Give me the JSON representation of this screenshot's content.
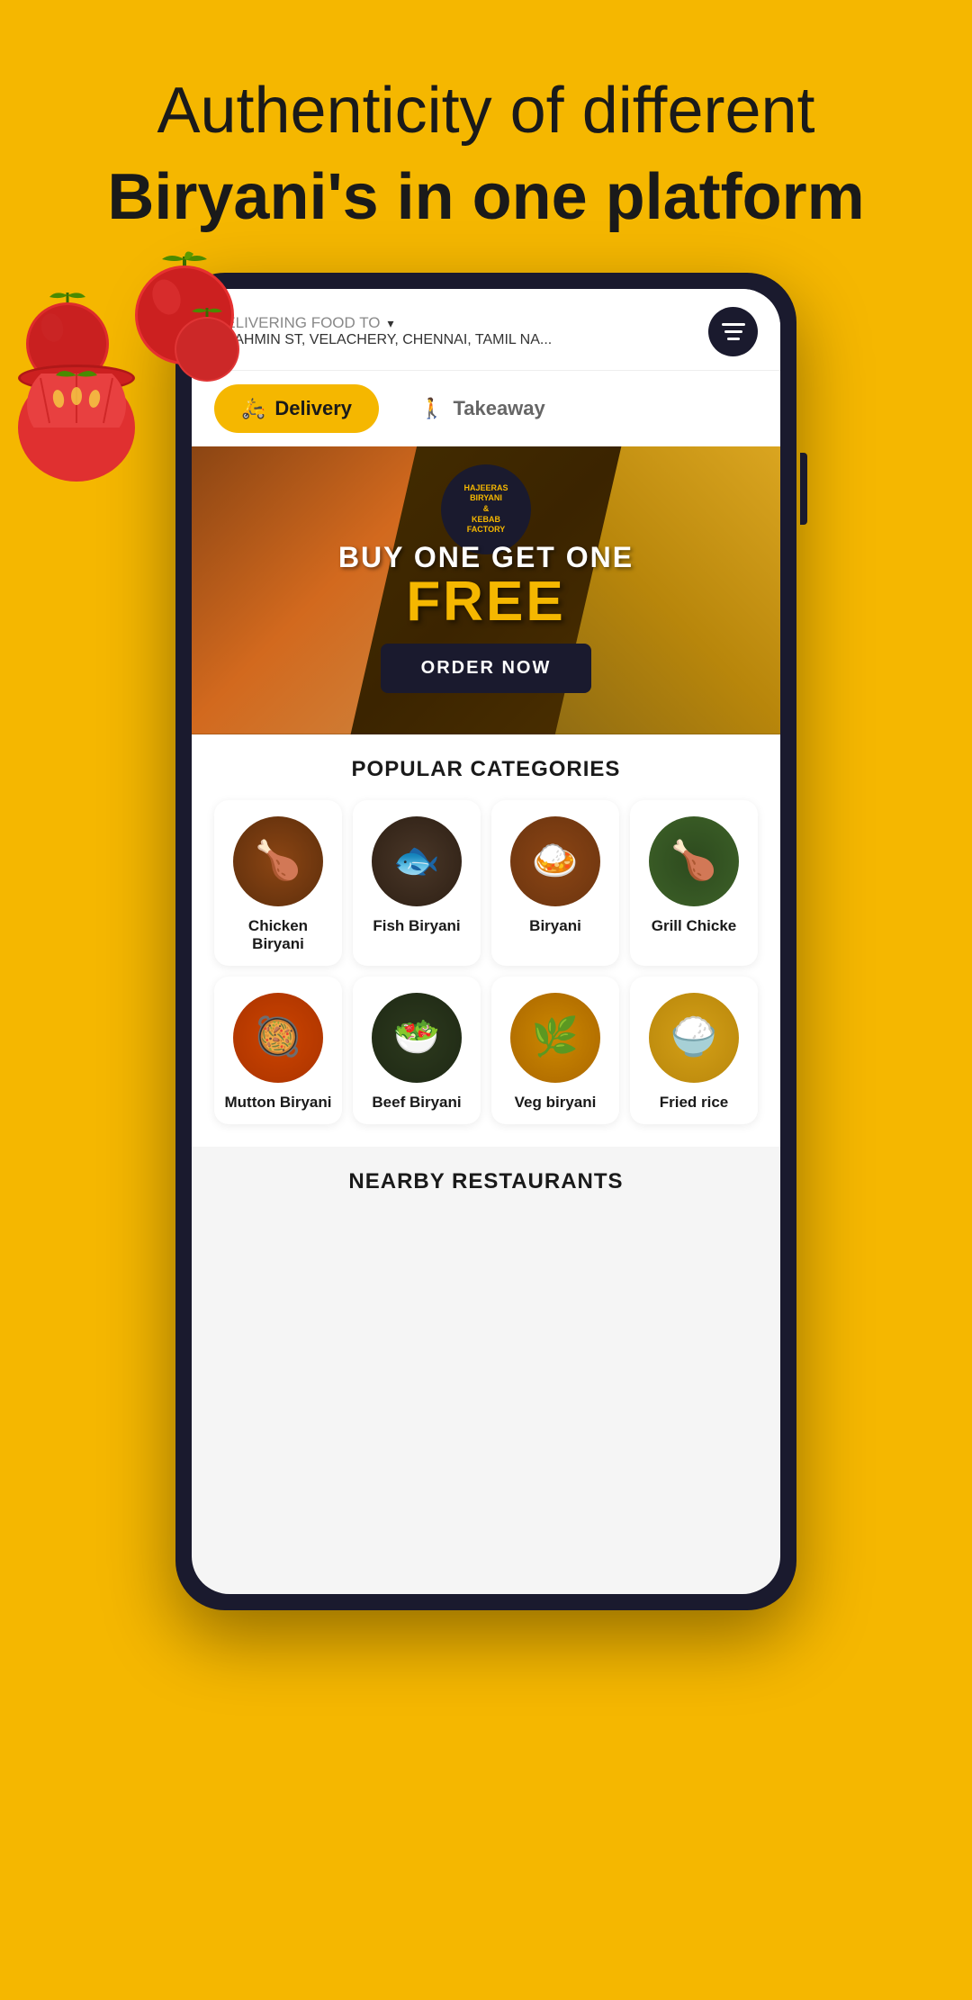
{
  "hero": {
    "title_light": "Authenticity of different",
    "title_bold": "Biryani's in one platform"
  },
  "address_bar": {
    "delivering_label": "DELIVERING FOOD TO",
    "address": "BRAHMIN ST, VELACHERY, CHENNAI, TAMIL NA...",
    "chevron": "▾"
  },
  "delivery_toggle": {
    "delivery_label": "Delivery",
    "takeaway_label": "Takeaway"
  },
  "banner": {
    "logo_line1": "HAJEERAS",
    "logo_line2": "BIRYANI",
    "logo_line3": "&",
    "logo_line4": "KEBAB",
    "logo_line5": "FACTORY",
    "promo_line1": "BUY ONE GET ONE",
    "promo_free": "FREE",
    "order_btn": "ORDER NOW"
  },
  "categories": {
    "section_title": "POPULAR CATEGORIES",
    "items": [
      {
        "label": "Chicken Biryani",
        "emoji": "🍗",
        "color_class": "food-chicken-biryani"
      },
      {
        "label": "Fish Biryani",
        "emoji": "🐟",
        "color_class": "food-fish-biryani"
      },
      {
        "label": "Biryani",
        "emoji": "🍛",
        "color_class": "food-biryani"
      },
      {
        "label": "Grill Chicke",
        "emoji": "🍗",
        "color_class": "food-grill"
      },
      {
        "label": "Mutton Biryani",
        "emoji": "🥘",
        "color_class": "food-mutton"
      },
      {
        "label": "Beef Biryani",
        "emoji": "🥗",
        "color_class": "food-beef"
      },
      {
        "label": "Veg biryani",
        "emoji": "🌿",
        "color_class": "food-veg"
      },
      {
        "label": "Fried rice",
        "emoji": "🍚",
        "color_class": "food-fried"
      }
    ]
  },
  "nearby": {
    "section_title": "NEARBY RESTAURANTS"
  },
  "icons": {
    "filter": "≡",
    "delivery_icon": "🛵",
    "takeaway_icon": "🚶"
  }
}
